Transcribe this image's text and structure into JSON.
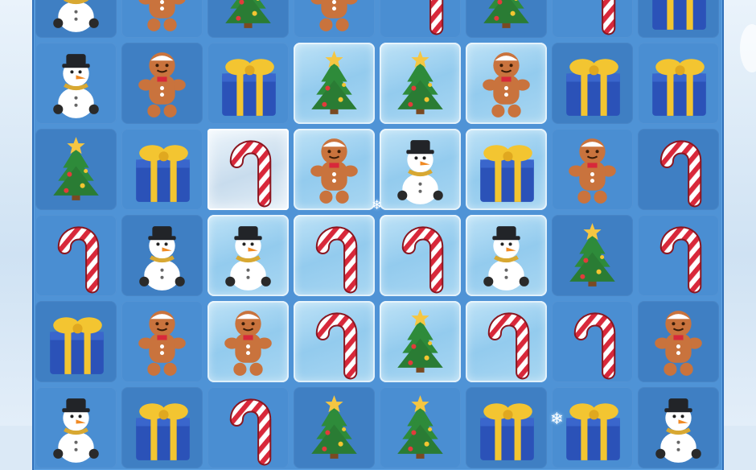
{
  "game": {
    "board": {
      "rows": [
        [
          "snowman",
          "gingerbread",
          "tree",
          "gingerbread",
          "candy-cane",
          "tree",
          "candy-cane",
          "gift"
        ],
        [
          "snowman",
          "gingerbread",
          "gift",
          "tree",
          "tree",
          "gingerbread",
          "gift",
          "gift"
        ],
        [
          "tree",
          "gift",
          "candy-cane",
          "gingerbread",
          "snowman",
          "gift",
          "gingerbread",
          "candy-cane"
        ],
        [
          "candy-cane",
          "snowman",
          "snowman",
          "candy-cane",
          "candy-cane",
          "snowman",
          "tree",
          "candy-cane"
        ],
        [
          "gift",
          "gingerbread",
          "gingerbread",
          "candy-cane",
          "tree",
          "candy-cane",
          "candy-cane",
          "gingerbread"
        ],
        [
          "snowman",
          "gift",
          "candy-cane",
          "tree",
          "tree",
          "gift",
          "gift",
          "snowman"
        ]
      ],
      "ice_layer": [
        [
          0,
          0,
          0,
          0,
          0,
          0,
          0,
          0
        ],
        [
          0,
          0,
          0,
          1,
          1,
          1,
          0,
          0
        ],
        [
          0,
          0,
          2,
          1,
          1,
          1,
          0,
          0
        ],
        [
          0,
          0,
          1,
          1,
          1,
          1,
          0,
          0
        ],
        [
          0,
          0,
          1,
          1,
          1,
          1,
          0,
          0
        ],
        [
          0,
          0,
          0,
          0,
          0,
          0,
          0,
          0
        ]
      ],
      "dark_tiles": [
        [
          1,
          0,
          1,
          0,
          0,
          1,
          0,
          1
        ],
        [
          0,
          1,
          0,
          0,
          0,
          0,
          1,
          0
        ],
        [
          1,
          0,
          0,
          0,
          0,
          0,
          0,
          1
        ],
        [
          0,
          1,
          0,
          0,
          0,
          0,
          1,
          0
        ],
        [
          1,
          0,
          0,
          0,
          0,
          0,
          0,
          1
        ],
        [
          0,
          1,
          0,
          1,
          0,
          1,
          0,
          1
        ]
      ]
    },
    "colors": {
      "board_blue": "#4f93d6",
      "tile_blue": "#4a8ed2",
      "ice_blue": "#a9d7f2",
      "candy_red": "#d8283a",
      "tree_green": "#2e8b3a",
      "gift_blue": "#2b52b8",
      "ribbon_gold": "#f3c531",
      "gingerbread_brown": "#c9733d"
    }
  }
}
